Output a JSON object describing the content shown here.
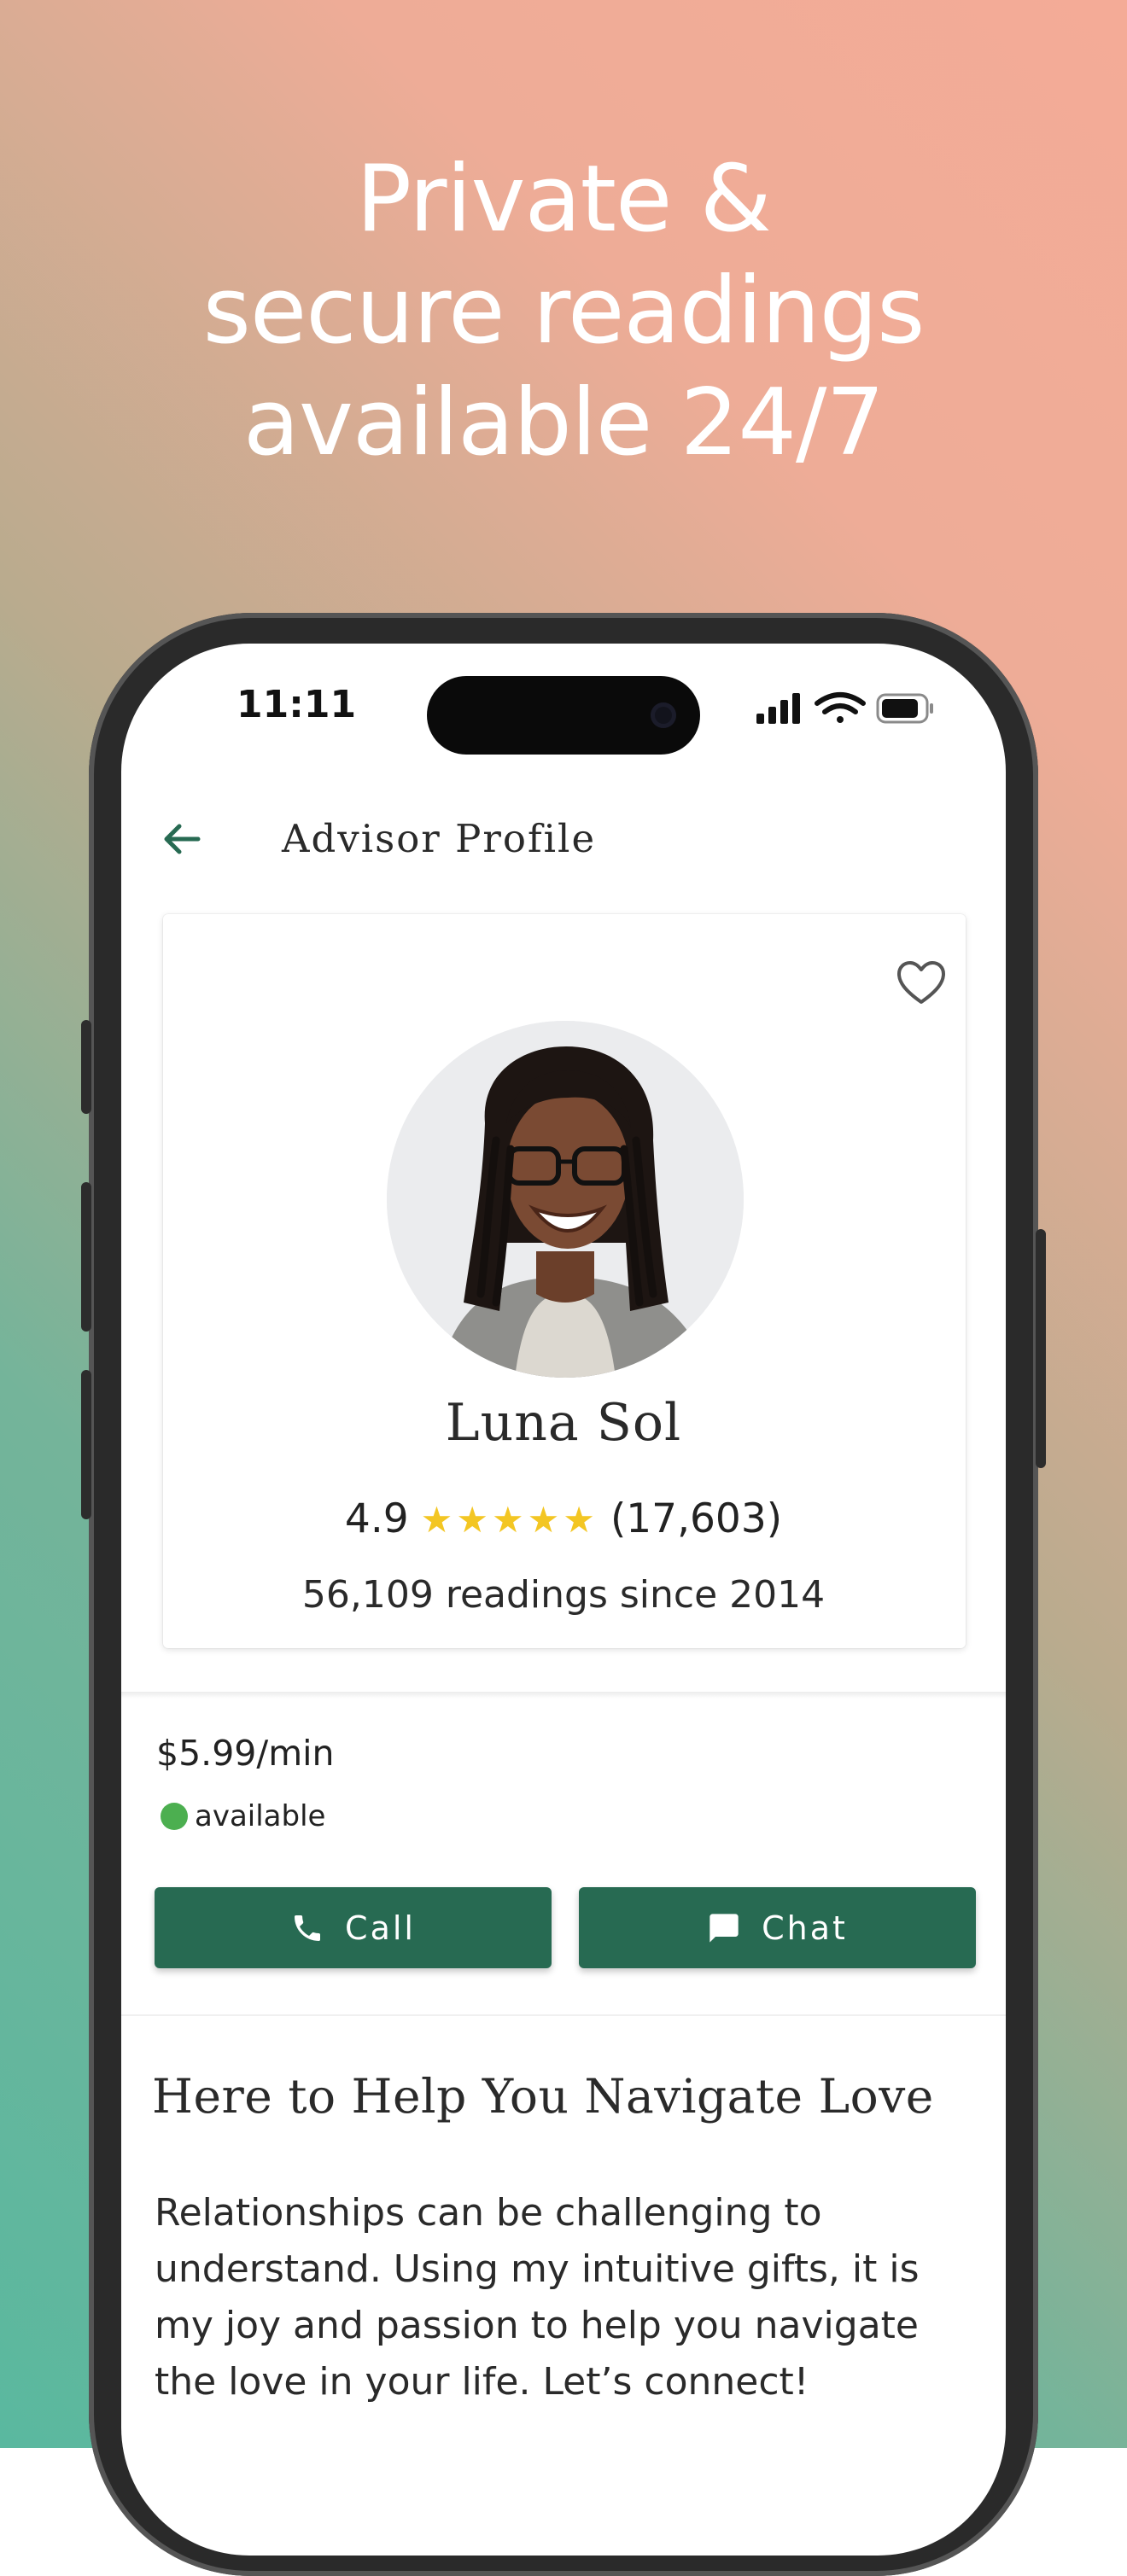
{
  "headline": {
    "line1": "Private &",
    "line2": "secure readings",
    "line3": "available 24/7"
  },
  "status_bar": {
    "time": "11:11",
    "icons": [
      "signal-icon",
      "wifi-icon",
      "battery-icon"
    ]
  },
  "header": {
    "title": "Advisor Profile",
    "back_icon": "back-arrow-icon"
  },
  "advisor": {
    "name": "Luna Sol",
    "rating": "4.9",
    "stars": "★★★★★",
    "rating_value": 4.9,
    "reviews": "(17,603)",
    "readings": "56,109 readings since 2014",
    "favorite_icon": "heart-outline-icon"
  },
  "pricing": {
    "price": "$5.99/min",
    "status": "available",
    "status_color": "#4caf50"
  },
  "actions": {
    "call_label": "Call",
    "chat_label": "Chat",
    "button_color": "#276a52"
  },
  "about": {
    "title": "Here to Help You Navigate Love",
    "bio": "Relationships can be challenging to understand. Using my intuitive gifts, it is my joy and passion to help you navigate the love in your life. Let’s connect!"
  },
  "colors": {
    "gradient_top_right": "#f4ab97",
    "gradient_bottom_left": "#5ab89f",
    "star": "#f3c623"
  }
}
